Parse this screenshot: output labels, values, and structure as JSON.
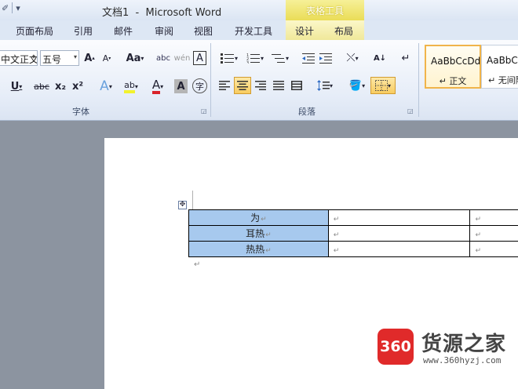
{
  "title_bar": {
    "title": "文档1  -  Microsoft Word",
    "qat_glyph": "✐",
    "qat_dropdown": "▾"
  },
  "context_tab_group": {
    "label": "表格工具",
    "color": "#eadc55"
  },
  "tabs": [
    {
      "label": "页面布局"
    },
    {
      "label": "引用"
    },
    {
      "label": "邮件"
    },
    {
      "label": "审阅"
    },
    {
      "label": "视图"
    },
    {
      "label": "开发工具"
    },
    {
      "label": "设计"
    },
    {
      "label": "布局"
    }
  ],
  "font_group": {
    "label": "字体",
    "font_name": "中文正文",
    "font_size": "五号",
    "grow_label": "A",
    "shrink_label": "A",
    "case_label": "Aa",
    "clear_label": "abc",
    "phonetic_label": "wén",
    "border_char_label": "A",
    "underline_label": "U",
    "strike_label": "abc",
    "subscript_label": "x₂",
    "superscript_label": "x²",
    "effects_label": "A",
    "highlight_label": "ab",
    "color_label": "A",
    "shade_label": "A",
    "circle_label": "字",
    "font_color": "#d9232a",
    "highlight_color": "#f2f22d"
  },
  "paragraph_group": {
    "label": "段落",
    "sort_label": "A↓"
  },
  "styles": [
    {
      "sample": "AaBbCcDd",
      "name": "↵ 正文",
      "selected": true
    },
    {
      "sample": "AaBbCc",
      "name": "↵ 无间隔",
      "selected": false
    }
  ],
  "document": {
    "table": [
      [
        "为",
        "",
        ""
      ],
      [
        "耳热",
        "",
        ""
      ],
      [
        "热热",
        "",
        ""
      ]
    ],
    "paragraph_mark": "↵",
    "selection_color": "#a7c9ee"
  },
  "watermark": {
    "logo_text": "360",
    "name": "货源之家",
    "url": "www.360hyzj.com"
  }
}
